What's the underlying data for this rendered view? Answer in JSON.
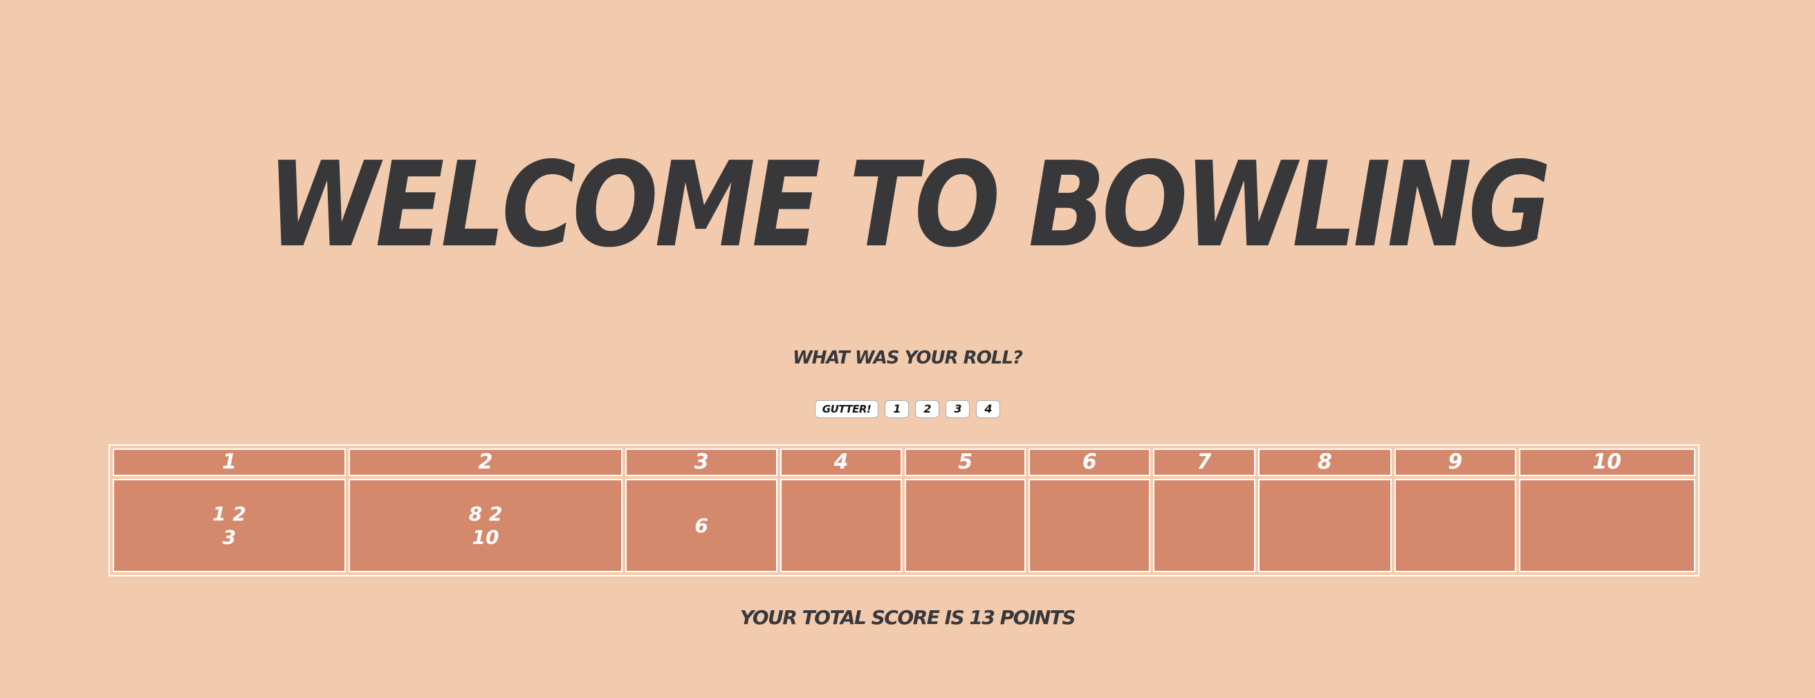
{
  "title": "WELCOME TO BOWLING",
  "prompt": "WHAT WAS YOUR ROLL?",
  "roll_buttons": [
    {
      "label": "GUTTER!"
    },
    {
      "label": "1"
    },
    {
      "label": "2"
    },
    {
      "label": "3"
    },
    {
      "label": "4"
    }
  ],
  "frames": [
    {
      "number": "1",
      "rolls": "1 2",
      "score": "3"
    },
    {
      "number": "2",
      "rolls": "8 2",
      "score": "10"
    },
    {
      "number": "3",
      "rolls": "6",
      "score": ""
    },
    {
      "number": "4",
      "rolls": "",
      "score": ""
    },
    {
      "number": "5",
      "rolls": "",
      "score": ""
    },
    {
      "number": "6",
      "rolls": "",
      "score": ""
    },
    {
      "number": "7",
      "rolls": "",
      "score": ""
    },
    {
      "number": "8",
      "rolls": "",
      "score": ""
    },
    {
      "number": "9",
      "rolls": "",
      "score": ""
    },
    {
      "number": "10",
      "rolls": "",
      "score": ""
    }
  ],
  "total": "YOUR TOTAL SCORE IS 13 POINTS",
  "colors": {
    "background": "#f2cbaf",
    "cell": "#d4896d",
    "text": "#38383b"
  }
}
